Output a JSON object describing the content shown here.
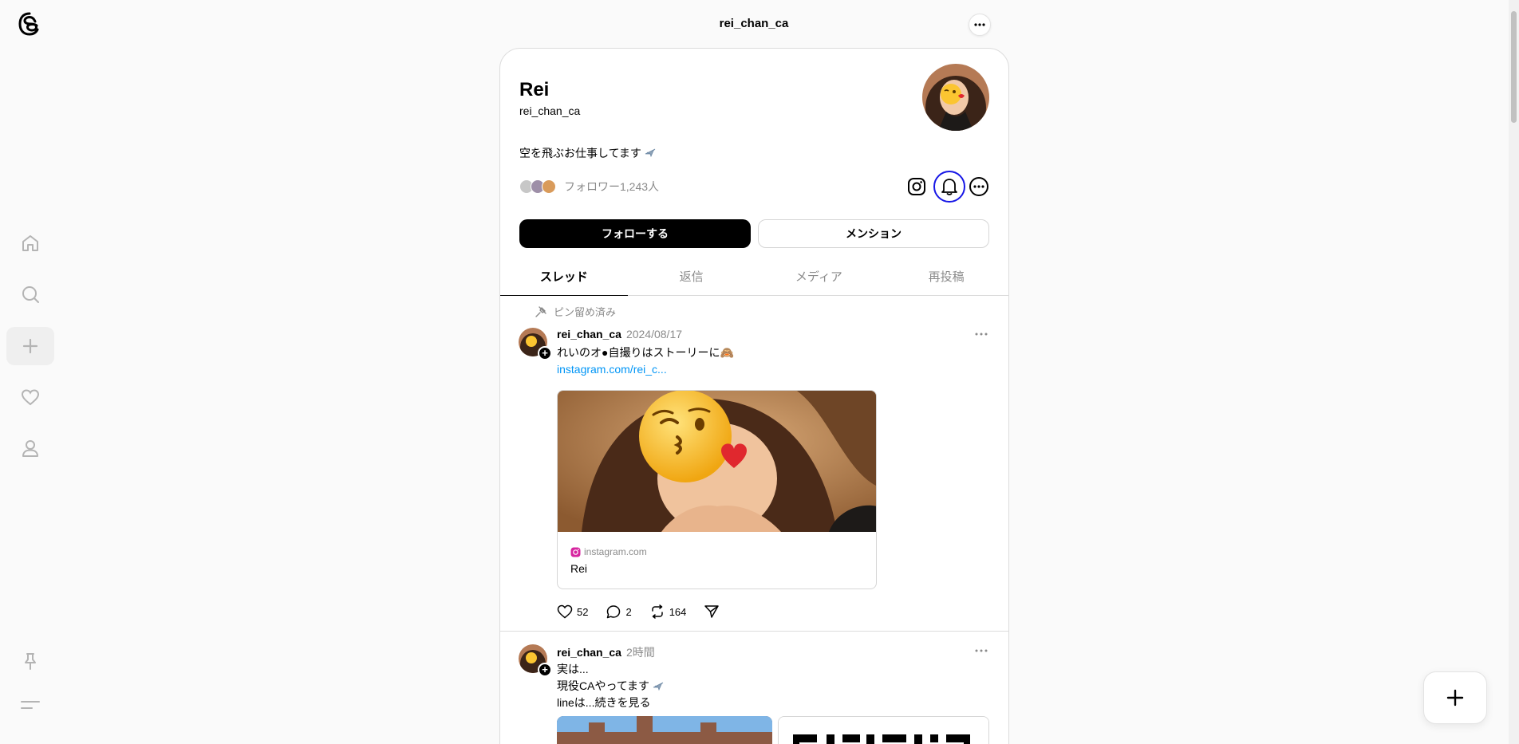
{
  "topbar": {
    "title": "rei_chan_ca"
  },
  "nav": {
    "items": [
      "home-icon",
      "search-icon",
      "create-icon",
      "activity-icon",
      "profile-icon"
    ],
    "bottom": [
      "pin-icon",
      "menu-icon"
    ]
  },
  "profile": {
    "name": "Rei",
    "handle": "rei_chan_ca",
    "bio": "空を飛ぶお仕事してます",
    "followers": "フォロワー1,243人",
    "follow_label": "フォローする",
    "mention_label": "メンション"
  },
  "tabs": [
    "スレッド",
    "返信",
    "メディア",
    "再投稿"
  ],
  "posts": [
    {
      "pinned_label": "ピン留め済み",
      "user": "rei_chan_ca",
      "time": "2024/08/17",
      "text": "れいのオ●自撮りはストーリーに🙈",
      "link": "instagram.com/rei_c...",
      "card": {
        "domain": "instagram.com",
        "title": "Rei"
      },
      "likes": "52",
      "replies": "2",
      "reposts": "164"
    },
    {
      "user": "rei_chan_ca",
      "time": "2時間",
      "lines": [
        "実は...",
        "現役CAやってます",
        "lineは...続きを見る"
      ]
    }
  ],
  "colors": {
    "link": "#0095f6",
    "focus_ring": "#1616e6",
    "muted": "#8a8a8a"
  }
}
